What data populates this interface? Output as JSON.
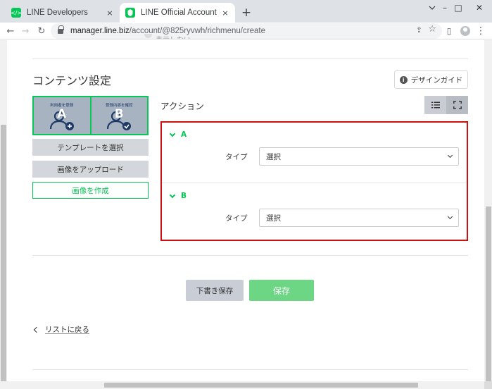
{
  "browser": {
    "tabs": [
      {
        "title": "LINE Developers",
        "active": false
      },
      {
        "title": "LINE Official Account Manager",
        "active": true
      }
    ],
    "url_host": "manager.line.biz",
    "url_path": "/account/@825ryvwh/richmenu/create",
    "icons": {
      "close": "×",
      "new_tab": "+",
      "back": "←",
      "forward": "→",
      "reload": "↻",
      "share": "⇪",
      "star": "☆",
      "panel": "▯",
      "menu": "⋮",
      "minimize": "–",
      "maximize": "□",
      "win_close": "✕"
    }
  },
  "page": {
    "cut_off_text": "表示しない",
    "content_settings_title": "コンテンツ設定",
    "design_guide_label": "デザインガイド",
    "preview": {
      "cells": [
        {
          "letter": "A",
          "caption": "利用者を登録"
        },
        {
          "letter": "B",
          "caption": "登録内容を確認"
        }
      ]
    },
    "buttons": {
      "select_template": "テンプレートを選択",
      "upload_image": "画像をアップロード",
      "create_image": "画像を作成",
      "save_draft": "下書き保存",
      "save": "保存"
    },
    "action_title": "アクション",
    "actions": [
      {
        "label": "A",
        "type_label": "タイプ",
        "select_value": "選択"
      },
      {
        "label": "B",
        "type_label": "タイプ",
        "select_value": "選択"
      }
    ],
    "back_link": "リストに戻る"
  },
  "colors": {
    "line_green": "#06c755",
    "highlight_red": "#cc1111",
    "save_green": "#6cd685"
  }
}
